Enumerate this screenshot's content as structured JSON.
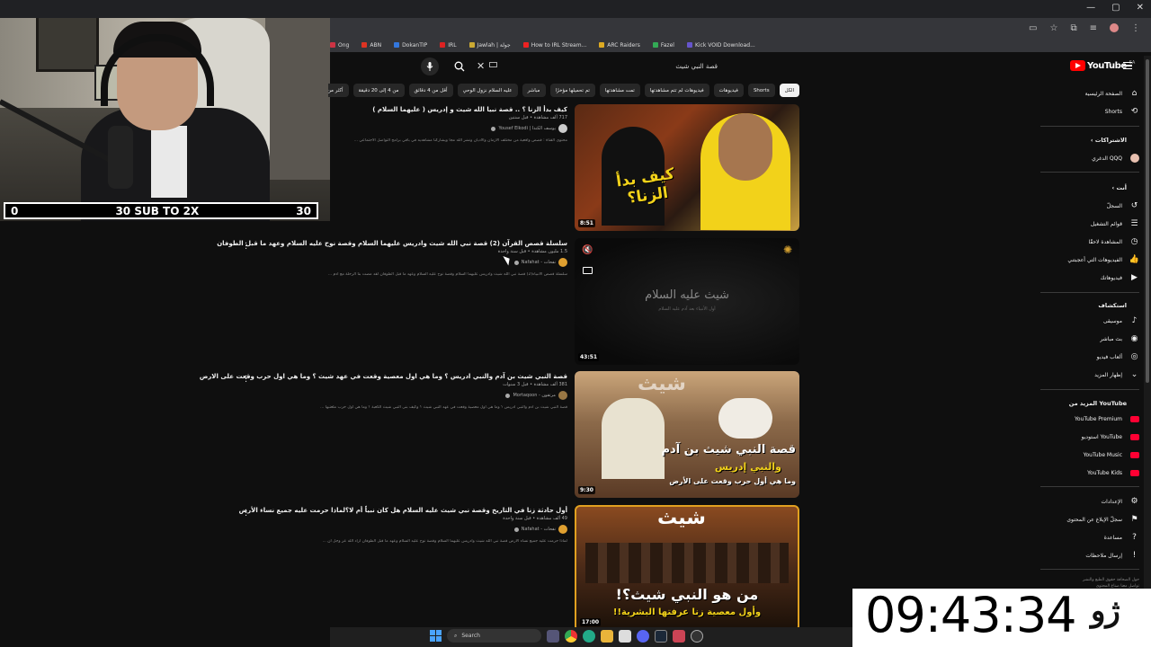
{
  "browser": {
    "window_controls": [
      "—",
      "▢",
      "✕"
    ],
    "bookmarks": [
      {
        "label": "Ong",
        "color": "#cc3344"
      },
      {
        "label": "ABN",
        "color": "#dd3322"
      },
      {
        "label": "DokanTIP",
        "color": "#3377dd"
      },
      {
        "label": "IRL",
        "color": "#dd2222"
      },
      {
        "label": "Jawlah | جولة",
        "color": "#ccaa33"
      },
      {
        "label": "How to IRL Stream...",
        "color": "#ee2222"
      },
      {
        "label": "ARC Raiders",
        "color": "#ddaa22"
      },
      {
        "label": "Fazel",
        "color": "#33aa55"
      },
      {
        "label": "Kick VOID Download...",
        "color": "#6655cc"
      }
    ]
  },
  "webcam": {
    "sub_goal": {
      "left": "0",
      "center": "30 SUB TO 2X",
      "right": "30"
    }
  },
  "search": {
    "query": "قصة النبي شيث",
    "clear_icon": "✕"
  },
  "logo": {
    "text": "YouTube",
    "region": "SA"
  },
  "chips": [
    {
      "label": "الكل",
      "active": true
    },
    {
      "label": "Shorts",
      "active": false
    },
    {
      "label": "فيديوهات",
      "active": false
    },
    {
      "label": "فيديوهات لم تتم مشاهدتها",
      "active": false
    },
    {
      "label": "تمت مشاهدتها",
      "active": false
    },
    {
      "label": "تم تحميلها مؤخرًا",
      "active": false
    },
    {
      "label": "مباشر",
      "active": false
    },
    {
      "label": "عليه السلام نزول الوحي",
      "active": false
    },
    {
      "label": "أقل من 4 دقائق",
      "active": false
    },
    {
      "label": "من 4 إلى 20 دقيقة",
      "active": false
    },
    {
      "label": "أكثر من 20 دقيقة",
      "active": false
    }
  ],
  "videos": [
    {
      "title": "كيف بدأ الزنا ؟ .. قصة نبيا الله شيث و إدريس ( عليهما السلام )",
      "meta": "717 ألف مشاهدة • قبل سنتين",
      "channel": "يوسف الكندا | Yousef Elkodi",
      "desc": "محتوى القناة : قصص واقعية من مختلف الأزمان والأديان ونشر الله مجا ويشاركنا مشاهديه في باقي برامج التواصل الاجتماعي ...",
      "duration": "8:51",
      "thumb_text": "كيف بدأ الزنا؟",
      "avatar_color": "#cccccc"
    },
    {
      "title": "سلسلة قصص القرآن (2) قصة نبي الله شيث وادريس عليهما السلام وقصة نوح عليه السلام وعهد ما قبل الطوفان",
      "meta": "1.5 مليون مشاهدة • قبل سنة واحدة",
      "channel": "نفحات - Nafahat",
      "desc": "سلسلة قصص الأنبياء(2) قصة نبي الله شيث وادريس عليهما السلام وقصة نوح عليه السلام وعهد ما قبل الطوفان لقد مضت بنا الرحلة مع آدم ...",
      "duration": "43:51",
      "thumb_text": "شيث عليه السلام",
      "thumb_sub": "أول الأنبياء بعد آدم عليه السلام",
      "avatar_color": "#e0a030"
    },
    {
      "title": "قصة النبي شيث بن آدم والنبي ادريس ؟ وما هي اول معصية وقعت في عهد شيث ؟ وما هي اول حرب وقعت على الارض",
      "meta": "381 ألف مشاهدة • قبل 3 سنوات",
      "channel": "مرتقون - Mortaqoon",
      "desc": "قصة النبي شيث بن آدم والنبي ادريس ؟ وما هي اول معصية وقعت في عهد النبي شيث ؟ وكيف بنى النبي شيث الكعبة ؟ وما هي اول حرب ملعتبها ...",
      "duration": "9:30",
      "thumb_text": "قصة النبي شيث بن آدم",
      "thumb_sub": "والنبي إدريس",
      "thumb_sub2": "وما هي أول حرب وقعت على الأرض",
      "thumb_top": "شيث",
      "avatar_color": "#997744"
    },
    {
      "title": "أول حادثة زنا في التاريخ وقصة نبي شيث عليه السلام هل كان نبياً أم لا؟لماذا حرمت عليه جميع نساء الأرض",
      "meta": "49 ألف مشاهدة • قبل سنة واحدة",
      "channel": "نفحات - Nafahat",
      "desc": "لماذا حرمت عليه جميع نساء الأرض قصة نبي الله شيث وادريس عليهما السلام وقصة نوح عليه السلام وعهد ما قبل الطوفان أراد الله عز وجل أن ...",
      "duration": "17:00",
      "thumb_text": "من هو النبي شيث؟!",
      "thumb_sub": "وأول معصية زنا عرفتها البشرية!!",
      "thumb_top": "شيث",
      "avatar_color": "#e0a030"
    }
  ],
  "sidebar": {
    "main": [
      {
        "label": "الصفحة الرئيسية",
        "icon": "home-icon",
        "glyph": "⌂"
      },
      {
        "label": "Shorts",
        "icon": "shorts-icon",
        "glyph": "⟲"
      }
    ],
    "subs_header": "الاشتراكات",
    "subs": [
      {
        "label": "الدغري QQQ",
        "icon": "channel-avatar"
      }
    ],
    "you_header": "أنت",
    "you": [
      {
        "label": "السجلّ",
        "icon": "history-icon",
        "glyph": "↺"
      },
      {
        "label": "قوائم التشغيل",
        "icon": "playlist-icon",
        "glyph": "☰"
      },
      {
        "label": "المشاهدة لاحقًا",
        "icon": "clock-icon",
        "glyph": "◷"
      },
      {
        "label": "الفيديوهات التي أعجبتني",
        "icon": "like-icon",
        "glyph": "👍"
      },
      {
        "label": "فيديوهاتك",
        "icon": "video-icon",
        "glyph": "▶"
      }
    ],
    "explore_header": "استكشاف",
    "explore": [
      {
        "label": "موسيقى",
        "icon": "music-icon",
        "glyph": "♪"
      },
      {
        "label": "بث مباشر",
        "icon": "live-icon",
        "glyph": "◉"
      },
      {
        "label": "ألعاب فيديو",
        "icon": "gaming-icon",
        "glyph": "◎"
      },
      {
        "label": "إظهار المزيد",
        "icon": "chevron-down-icon",
        "glyph": "⌄"
      }
    ],
    "more_header": "المزيد من YouTube",
    "more": [
      {
        "label": "YouTube Premium",
        "icon": "premium-icon"
      },
      {
        "label": "استوديو YouTube",
        "icon": "studio-icon"
      },
      {
        "label": "YouTube Music",
        "icon": "music-app-icon"
      },
      {
        "label": "YouTube Kids",
        "icon": "kids-icon"
      }
    ],
    "settings": [
      {
        "label": "الإعدادات",
        "icon": "gear-icon",
        "glyph": "⚙"
      },
      {
        "label": "سجلّ الإبلاغ عن المحتوى",
        "icon": "flag-icon",
        "glyph": "⚑"
      },
      {
        "label": "مساعدة",
        "icon": "help-icon",
        "glyph": "?"
      },
      {
        "label": "إرسال ملاحظات",
        "icon": "feedback-icon",
        "glyph": "!"
      }
    ],
    "footer": [
      "حول  الصحافة  حقوق الطبع والنشر",
      "تواصل معنا  صناع المحتوى"
    ]
  },
  "overlay": {
    "clock": "09:43:34",
    "mark": "ژو"
  },
  "taskbar": {
    "search_label": "Search"
  }
}
